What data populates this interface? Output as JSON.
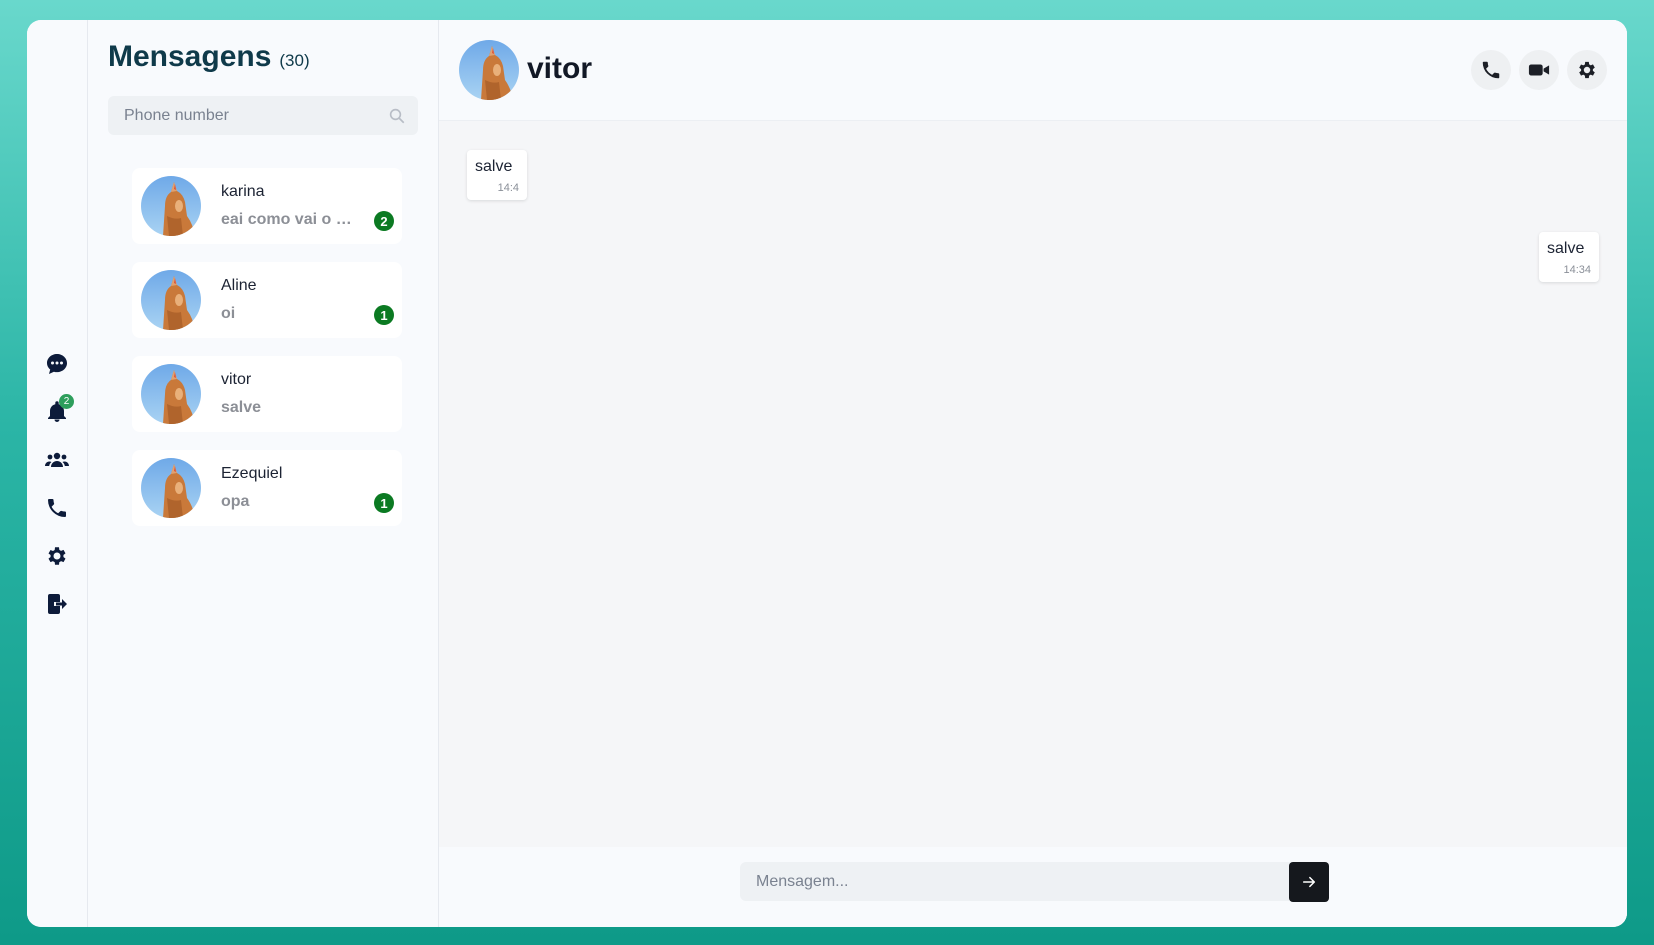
{
  "rail": {
    "items": [
      {
        "name": "chat-icon"
      },
      {
        "name": "bell-icon",
        "badge": "2"
      },
      {
        "name": "users-icon"
      },
      {
        "name": "phone-icon"
      },
      {
        "name": "gear-icon"
      },
      {
        "name": "logout-icon"
      }
    ]
  },
  "contacts": {
    "title": "Mensagens",
    "count": "(30)",
    "search_placeholder": "Phone number",
    "items": [
      {
        "name": "karina",
        "preview": "eai como vai o nosso projeto",
        "unread": "2"
      },
      {
        "name": "Aline",
        "preview": "oi",
        "unread": "1"
      },
      {
        "name": "vitor",
        "preview": "salve",
        "unread": ""
      },
      {
        "name": "Ezequiel",
        "preview": "opa",
        "unread": "1"
      }
    ]
  },
  "chat": {
    "name": "vitor",
    "messages": [
      {
        "text": "salve",
        "time": "14:4",
        "direction": "incoming"
      },
      {
        "text": "salve",
        "time": "14:34",
        "direction": "outgoing"
      }
    ],
    "input_placeholder": "Mensagem..."
  },
  "colors": {
    "accent_badge": "#0b7a22",
    "send_button": "#15181d",
    "title": "#0f3a4a"
  }
}
